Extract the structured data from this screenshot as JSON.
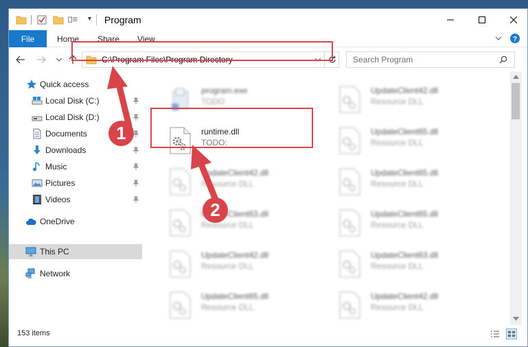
{
  "window": {
    "title": "Program"
  },
  "ribbon": {
    "tabs": [
      "File",
      "Home",
      "Share",
      "View"
    ]
  },
  "nav": {
    "address": "C:\\Program Files\\Program Directory",
    "search_placeholder": "Search Program"
  },
  "sidebar": {
    "items": [
      {
        "label": "Quick access"
      },
      {
        "label": "Local Disk (C:)"
      },
      {
        "label": "Local Disk (D:)"
      },
      {
        "label": "Documents"
      },
      {
        "label": "Downloads"
      },
      {
        "label": "Music"
      },
      {
        "label": "Pictures"
      },
      {
        "label": "Videos"
      },
      {
        "label": "OneDrive"
      },
      {
        "label": "This PC"
      },
      {
        "label": "Network"
      }
    ]
  },
  "files": {
    "left": [
      {
        "name": "program.exe",
        "type": "TODO"
      },
      {
        "name": "runtime.dll",
        "type": "TODO:"
      },
      {
        "name": "UpdateClient42.dll",
        "type": "Resource DLL"
      },
      {
        "name": "UpdateClient63.dll",
        "type": "Resource DLL"
      },
      {
        "name": "UpdateClient42.dll",
        "type": "Resource DLL"
      },
      {
        "name": "UpdateClient65.dll",
        "type": "Resource DLL"
      }
    ],
    "right": [
      {
        "name": "UpdateClient42.dll",
        "type": "Resource DLL"
      },
      {
        "name": "UpdateClient65.dll",
        "type": "Resource DLL"
      },
      {
        "name": "UpdateClient65.dll",
        "type": "Resource DLL"
      },
      {
        "name": "UpdateClient65.dll",
        "type": "Resource DLL"
      },
      {
        "name": "UpdateClient63.dll",
        "type": "Resource DLL"
      },
      {
        "name": "UpdateClient42.dll",
        "type": "Resource DLL"
      }
    ]
  },
  "status": {
    "count": "153 items"
  },
  "callouts": {
    "one": "1",
    "two": "2"
  },
  "colors": {
    "accent": "#1979ca",
    "highlight": "#d9444a",
    "selection": "#d9d9d9"
  }
}
